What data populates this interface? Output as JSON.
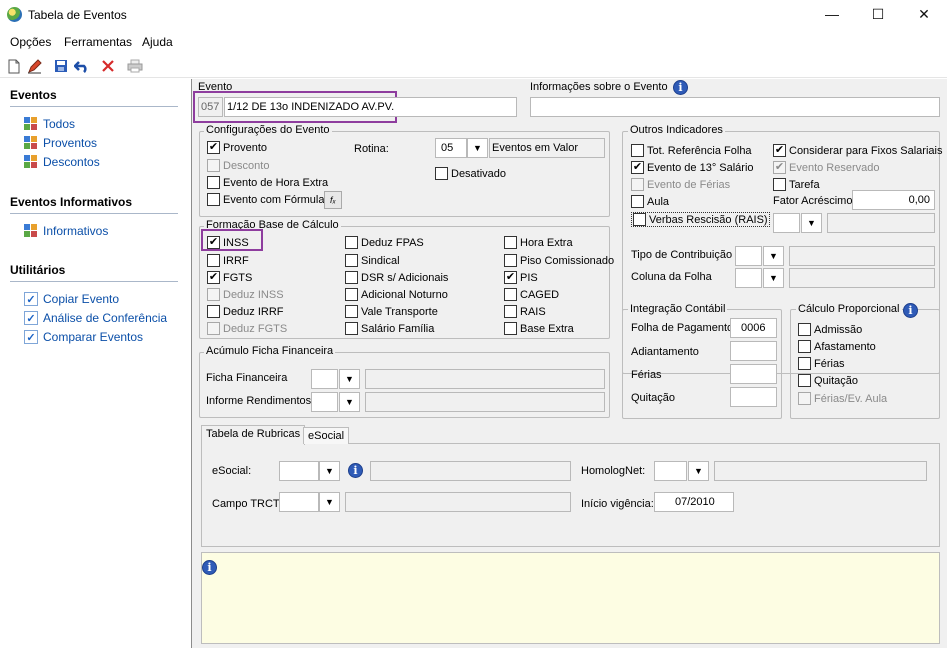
{
  "window": {
    "title": "Tabela de Eventos",
    "minimize": "—",
    "maximize": "☐",
    "close": "✕"
  },
  "menu": {
    "opcoes": "Opções",
    "ferramentas": "Ferramentas",
    "ajuda": "Ajuda"
  },
  "toolbar": {
    "icons": [
      "new-icon",
      "edit-icon",
      "save-icon",
      "undo-icon",
      "delete-icon",
      "print-icon"
    ]
  },
  "sidebar": {
    "eventos_title": "Eventos",
    "eventos_items": [
      "Todos",
      "Proventos",
      "Descontos"
    ],
    "informativos_title": "Eventos Informativos",
    "informativos_items": [
      "Informativos"
    ],
    "utilitarios_title": "Utilitários",
    "utilitarios_items": [
      "Copiar Evento",
      "Análise de Conferência",
      "Comparar Eventos"
    ]
  },
  "evento": {
    "label": "Evento",
    "code": "057",
    "name": "1/12 DE 13o INDENIZADO AV.PV."
  },
  "informacoes": {
    "label": "Informações sobre o Evento",
    "value": ""
  },
  "configuracoes": {
    "title": "Configurações do Evento",
    "provento": "Provento",
    "desconto": "Desconto",
    "hora_extra": "Evento de Hora Extra",
    "formula": "Evento com Fórmula",
    "formula_btn": "fₓ",
    "rotina_label": "Rotina:",
    "rotina_code": "05",
    "rotina_desc": "Eventos em Valor",
    "desativado": "Desativado"
  },
  "base_calculo": {
    "title": "Formação Base de Cálculo",
    "col1": [
      {
        "label": "INSS",
        "checked": true,
        "disabled": false
      },
      {
        "label": "IRRF",
        "checked": false,
        "disabled": false
      },
      {
        "label": "FGTS",
        "checked": true,
        "disabled": false
      },
      {
        "label": "Deduz INSS",
        "checked": false,
        "disabled": true
      },
      {
        "label": "Deduz IRRF",
        "checked": false,
        "disabled": false
      },
      {
        "label": "Deduz FGTS",
        "checked": false,
        "disabled": true
      }
    ],
    "col2": [
      {
        "label": "Deduz FPAS",
        "checked": false,
        "disabled": false
      },
      {
        "label": "Sindical",
        "checked": false,
        "disabled": false
      },
      {
        "label": "DSR s/ Adicionais",
        "checked": false,
        "disabled": false
      },
      {
        "label": "Adicional Noturno",
        "checked": false,
        "disabled": false
      },
      {
        "label": "Vale Transporte",
        "checked": false,
        "disabled": false
      },
      {
        "label": "Salário Família",
        "checked": false,
        "disabled": false
      }
    ],
    "col3": [
      {
        "label": "Hora Extra",
        "checked": false,
        "disabled": false
      },
      {
        "label": "Piso Comissionado",
        "checked": false,
        "disabled": false
      },
      {
        "label": "PIS",
        "checked": true,
        "disabled": false
      },
      {
        "label": "CAGED",
        "checked": false,
        "disabled": false
      },
      {
        "label": "RAIS",
        "checked": false,
        "disabled": false
      },
      {
        "label": "Base Extra",
        "checked": false,
        "disabled": false
      }
    ]
  },
  "acumulo": {
    "title": "Acúmulo Ficha Financeira",
    "ficha_label": "Ficha Financeira",
    "informe_label": "Informe Rendimentos"
  },
  "outros": {
    "title": "Outros Indicadores",
    "tot_ref": "Tot. Referência Folha",
    "evento_13": "Evento de 13° Salário",
    "evento_ferias": "Evento de Férias",
    "aula": "Aula",
    "verbas": "Verbas Rescisão (RAIS)",
    "fixos": "Considerar para Fixos Salariais",
    "reservado": "Evento Reservado",
    "tarefa": "Tarefa",
    "fator_label": "Fator Acréscimo",
    "fator_value": "0,00",
    "tipo_contrib": "Tipo de Contribuição",
    "coluna_folha": "Coluna da Folha"
  },
  "integracao": {
    "title": "Integração Contábil",
    "folha_label": "Folha de Pagamento",
    "folha_value": "0006",
    "adiantamento": "Adiantamento",
    "ferias": "Férias",
    "quitacao": "Quitação"
  },
  "proporcional": {
    "title": "Cálculo Proporcional",
    "admissao": "Admissão",
    "afastamento": "Afastamento",
    "ferias": "Férias",
    "quitacao": "Quitação",
    "ferias_aula": "Férias/Ev. Aula"
  },
  "tabs": {
    "rubricas": "Tabela de Rubricas",
    "esocial": "eSocial"
  },
  "rubricas": {
    "esocial_label": "eSocial:",
    "homolognet_label": "HomologNet:",
    "campo_trct_label": "Campo TRCT:",
    "inicio_label": "Início vigência:",
    "inicio_value": "07/2010"
  },
  "info_icon": "i"
}
